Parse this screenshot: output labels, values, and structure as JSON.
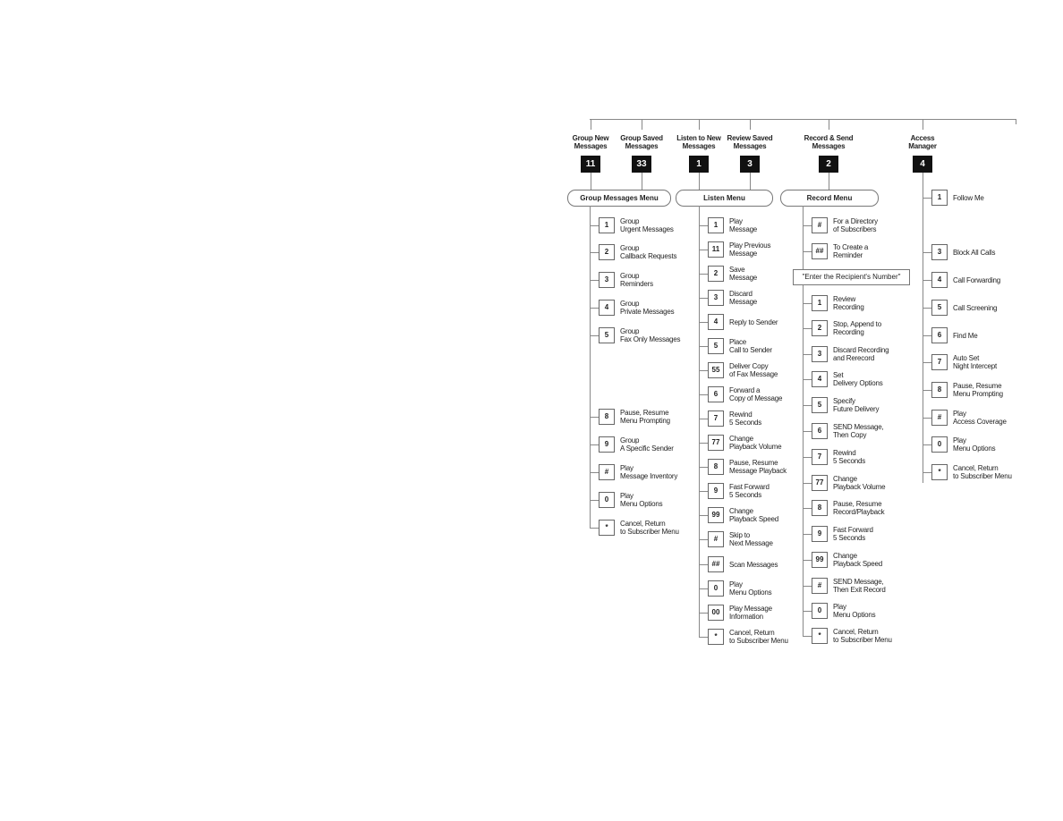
{
  "headers": [
    {
      "title": [
        "Group New",
        "Messages"
      ],
      "key": "11"
    },
    {
      "title": [
        "Group Saved",
        "Messages"
      ],
      "key": "33"
    },
    {
      "title": [
        "Listen to New",
        "Messages"
      ],
      "key": "1"
    },
    {
      "title": [
        "Review Saved",
        "Messages"
      ],
      "key": "3"
    },
    {
      "title": [
        "Record & Send",
        "Messages"
      ],
      "key": "2"
    },
    {
      "title": [
        "Access",
        "Manager"
      ],
      "key": "4"
    }
  ],
  "menus": [
    "Group Messages Menu",
    "Listen Menu",
    "Record Menu"
  ],
  "record_prompt": "\"Enter the Recipient's Number\"",
  "columns": [
    {
      "items": [
        {
          "key": "1",
          "label": "Group\nUrgent Messages"
        },
        {
          "key": "2",
          "label": "Group\nCallback Requests"
        },
        {
          "key": "3",
          "label": "Group\nReminders"
        },
        {
          "key": "4",
          "label": "Group\nPrivate Messages"
        },
        {
          "key": "5",
          "label": "Group\nFax Only Messages"
        },
        {
          "key": "8",
          "label": "Pause, Resume\nMenu Prompting"
        },
        {
          "key": "9",
          "label": "Group\nA Specific Sender"
        },
        {
          "key": "#",
          "label": "Play\nMessage Inventory"
        },
        {
          "key": "0",
          "label": "Play\nMenu Options"
        },
        {
          "key": "*",
          "label": "Cancel, Return\nto Subscriber Menu"
        }
      ]
    },
    {
      "items": [
        {
          "key": "1",
          "label": "Play\nMessage"
        },
        {
          "key": "11",
          "label": "Play Previous\nMessage"
        },
        {
          "key": "2",
          "label": "Save\nMessage"
        },
        {
          "key": "3",
          "label": "Discard\nMessage"
        },
        {
          "key": "4",
          "label": "Reply to Sender"
        },
        {
          "key": "5",
          "label": "Place\nCall to Sender"
        },
        {
          "key": "55",
          "label": "Deliver Copy\nof Fax Message"
        },
        {
          "key": "6",
          "label": "Forward a\nCopy of Message"
        },
        {
          "key": "7",
          "label": "Rewind\n5 Seconds"
        },
        {
          "key": "77",
          "label": "Change\nPlayback Volume"
        },
        {
          "key": "8",
          "label": "Pause, Resume\nMessage Playback"
        },
        {
          "key": "9",
          "label": "Fast Forward\n5 Seconds"
        },
        {
          "key": "99",
          "label": "Change\nPlayback Speed"
        },
        {
          "key": "#",
          "label": "Skip to\nNext Message"
        },
        {
          "key": "##",
          "label": "Scan Messages"
        },
        {
          "key": "0",
          "label": "Play\nMenu Options"
        },
        {
          "key": "00",
          "label": "Play Message\nInformation"
        },
        {
          "key": "*",
          "label": "Cancel, Return\nto Subscriber Menu"
        }
      ]
    },
    {
      "items": [
        {
          "key": "#",
          "label": "For a Directory\nof Subscribers"
        },
        {
          "key": "##",
          "label": "To Create a\nReminder"
        },
        {
          "key": "1",
          "label": "Review\nRecording"
        },
        {
          "key": "2",
          "label": "Stop, Append to\nRecording"
        },
        {
          "key": "3",
          "label": "Discard Recording\nand Rerecord"
        },
        {
          "key": "4",
          "label": "Set\nDelivery Options"
        },
        {
          "key": "5",
          "label": "Specify\nFuture Delivery"
        },
        {
          "key": "6",
          "label": "SEND Message,\nThen Copy"
        },
        {
          "key": "7",
          "label": "Rewind\n5 Seconds"
        },
        {
          "key": "77",
          "label": "Change\nPlayback Volume"
        },
        {
          "key": "8",
          "label": "Pause, Resume\nRecord/Playback"
        },
        {
          "key": "9",
          "label": "Fast Forward\n5 Seconds"
        },
        {
          "key": "99",
          "label": "Change\nPlayback Speed"
        },
        {
          "key": "#",
          "label": "SEND Message,\nThen Exit Record"
        },
        {
          "key": "0",
          "label": "Play\nMenu Options"
        },
        {
          "key": "*",
          "label": "Cancel, Return\nto Subscriber Menu"
        }
      ]
    },
    {
      "items": [
        {
          "key": "1",
          "label": "Follow Me"
        },
        {
          "key": "3",
          "label": "Block All Calls"
        },
        {
          "key": "4",
          "label": "Call Forwarding"
        },
        {
          "key": "5",
          "label": "Call Screening"
        },
        {
          "key": "6",
          "label": "Find Me"
        },
        {
          "key": "7",
          "label": "Auto Set\nNight Intercept"
        },
        {
          "key": "8",
          "label": "Pause, Resume\nMenu Prompting"
        },
        {
          "key": "#",
          "label": "Play\nAccess Coverage"
        },
        {
          "key": "0",
          "label": "Play\nMenu Options"
        },
        {
          "key": "*",
          "label": "Cancel, Return\nto Subscriber Menu"
        }
      ]
    }
  ]
}
